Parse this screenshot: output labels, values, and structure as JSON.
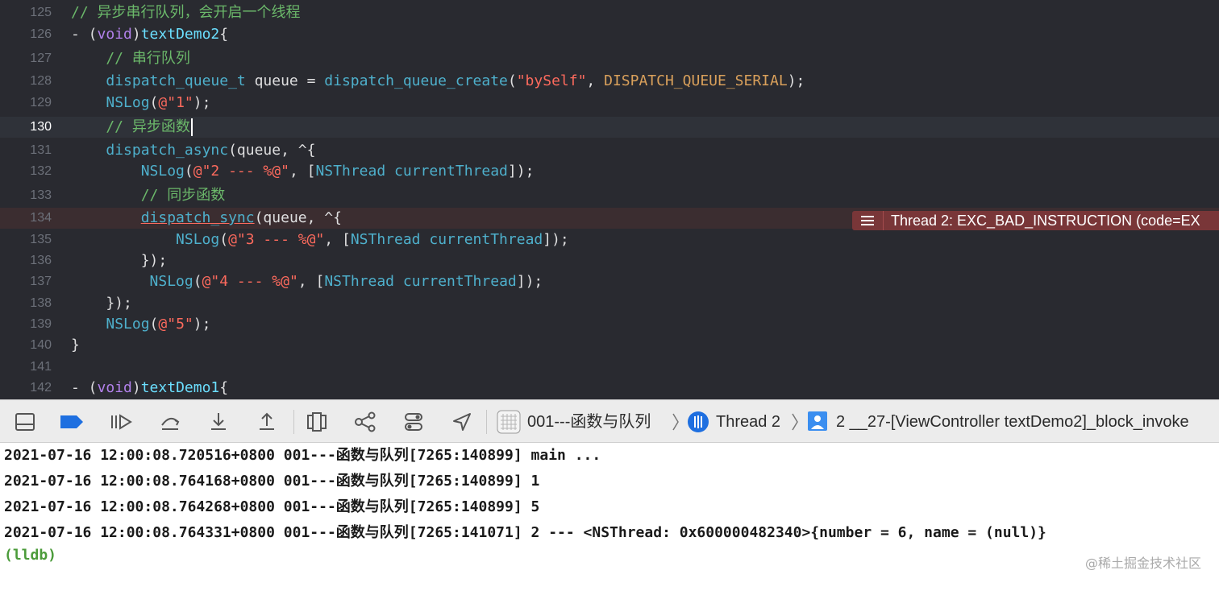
{
  "editor": {
    "lines": [
      {
        "num": "125",
        "tokens": [
          {
            "t": "// 异步串行队列，会开启一个线程",
            "c": "comment"
          }
        ]
      },
      {
        "num": "126",
        "tokens": [
          {
            "t": "- (",
            "c": "plain"
          },
          {
            "t": "void",
            "c": "keyword"
          },
          {
            "t": ")",
            "c": "plain"
          },
          {
            "t": "textDemo2",
            "c": "method"
          },
          {
            "t": "{",
            "c": "plain"
          }
        ]
      },
      {
        "num": "127",
        "tokens": [
          {
            "t": "    // 串行队列",
            "c": "comment"
          }
        ]
      },
      {
        "num": "128",
        "tokens": [
          {
            "t": "    ",
            "c": "plain"
          },
          {
            "t": "dispatch_queue_t",
            "c": "type"
          },
          {
            "t": " queue = ",
            "c": "plain"
          },
          {
            "t": "dispatch_queue_create",
            "c": "func"
          },
          {
            "t": "(",
            "c": "plain"
          },
          {
            "t": "\"bySelf\"",
            "c": "string"
          },
          {
            "t": ", ",
            "c": "plain"
          },
          {
            "t": "DISPATCH_QUEUE_SERIAL",
            "c": "const"
          },
          {
            "t": ");",
            "c": "plain"
          }
        ]
      },
      {
        "num": "129",
        "tokens": [
          {
            "t": "    ",
            "c": "plain"
          },
          {
            "t": "NSLog",
            "c": "func"
          },
          {
            "t": "(",
            "c": "plain"
          },
          {
            "t": "@\"1\"",
            "c": "string"
          },
          {
            "t": ");",
            "c": "plain"
          }
        ]
      },
      {
        "num": "130",
        "current": true,
        "tokens": [
          {
            "t": "    // 异步函数",
            "c": "comment"
          }
        ]
      },
      {
        "num": "131",
        "tokens": [
          {
            "t": "    ",
            "c": "plain"
          },
          {
            "t": "dispatch_async",
            "c": "func"
          },
          {
            "t": "(queue, ^{",
            "c": "plain"
          }
        ]
      },
      {
        "num": "132",
        "tokens": [
          {
            "t": "        ",
            "c": "plain"
          },
          {
            "t": "NSLog",
            "c": "func"
          },
          {
            "t": "(",
            "c": "plain"
          },
          {
            "t": "@\"2 --- %@\"",
            "c": "string"
          },
          {
            "t": ", [",
            "c": "plain"
          },
          {
            "t": "NSThread",
            "c": "type"
          },
          {
            "t": " ",
            "c": "plain"
          },
          {
            "t": "currentThread",
            "c": "func"
          },
          {
            "t": "]);",
            "c": "plain"
          }
        ]
      },
      {
        "num": "133",
        "tokens": [
          {
            "t": "        // 同步函数",
            "c": "comment"
          }
        ]
      },
      {
        "num": "134",
        "error": true,
        "tokens": [
          {
            "t": "        ",
            "c": "plain"
          },
          {
            "t": "dispatch_sync",
            "c": "func",
            "u": true
          },
          {
            "t": "(queue, ^{",
            "c": "plain"
          }
        ]
      },
      {
        "num": "135",
        "tokens": [
          {
            "t": "            ",
            "c": "plain"
          },
          {
            "t": "NSLog",
            "c": "func"
          },
          {
            "t": "(",
            "c": "plain"
          },
          {
            "t": "@\"3 --- %@\"",
            "c": "string"
          },
          {
            "t": ", [",
            "c": "plain"
          },
          {
            "t": "NSThread",
            "c": "type"
          },
          {
            "t": " ",
            "c": "plain"
          },
          {
            "t": "currentThread",
            "c": "func"
          },
          {
            "t": "]);",
            "c": "plain"
          }
        ]
      },
      {
        "num": "136",
        "tokens": [
          {
            "t": "        });",
            "c": "plain"
          }
        ]
      },
      {
        "num": "137",
        "tokens": [
          {
            "t": "         ",
            "c": "plain"
          },
          {
            "t": "NSLog",
            "c": "func"
          },
          {
            "t": "(",
            "c": "plain"
          },
          {
            "t": "@\"4 --- %@\"",
            "c": "string"
          },
          {
            "t": ", [",
            "c": "plain"
          },
          {
            "t": "NSThread",
            "c": "type"
          },
          {
            "t": " ",
            "c": "plain"
          },
          {
            "t": "currentThread",
            "c": "func"
          },
          {
            "t": "]);",
            "c": "plain"
          }
        ]
      },
      {
        "num": "138",
        "tokens": [
          {
            "t": "    });",
            "c": "plain"
          }
        ]
      },
      {
        "num": "139",
        "tokens": [
          {
            "t": "    ",
            "c": "plain"
          },
          {
            "t": "NSLog",
            "c": "func"
          },
          {
            "t": "(",
            "c": "plain"
          },
          {
            "t": "@\"5\"",
            "c": "string"
          },
          {
            "t": ");",
            "c": "plain"
          }
        ]
      },
      {
        "num": "140",
        "tokens": [
          {
            "t": "}",
            "c": "plain"
          }
        ]
      },
      {
        "num": "141",
        "tokens": []
      },
      {
        "num": "142",
        "tokens": [
          {
            "t": "- (",
            "c": "plain"
          },
          {
            "t": "void",
            "c": "keyword"
          },
          {
            "t": ")",
            "c": "plain"
          },
          {
            "t": "textDemo1",
            "c": "method"
          },
          {
            "t": "{",
            "c": "plain"
          }
        ]
      }
    ],
    "error_message": "Thread 2: EXC_BAD_INSTRUCTION (code=EX"
  },
  "debug_bar": {
    "buttons": [
      {
        "name": "hide-debug-area-icon"
      },
      {
        "name": "breakpoints-toggle-icon"
      },
      {
        "name": "continue-icon"
      },
      {
        "name": "step-over-icon"
      },
      {
        "name": "step-into-icon"
      },
      {
        "name": "step-out-icon"
      },
      {
        "name": "view-debugger-icon"
      },
      {
        "name": "memory-graph-icon"
      },
      {
        "name": "environment-overrides-icon"
      },
      {
        "name": "simulate-location-icon"
      }
    ],
    "breadcrumb": {
      "target": "001---函数与队列",
      "thread": "Thread 2",
      "frame": "2 __27-[ViewController textDemo2]_block_invoke"
    },
    "colors": {
      "accent": "#1e6fe0",
      "error": "#793638"
    }
  },
  "console": {
    "lines": [
      "2021-07-16 12:00:08.720516+0800 001---函数与队列[7265:140899] main ...",
      "2021-07-16 12:00:08.764168+0800 001---函数与队列[7265:140899] 1",
      "2021-07-16 12:00:08.764268+0800 001---函数与队列[7265:140899] 5",
      "2021-07-16 12:00:08.764331+0800 001---函数与队列[7265:141071] 2 --- <NSThread: 0x600000482340>{number = 6, name = (null)}"
    ],
    "prompt": "(lldb)"
  },
  "watermark": "@稀土掘金技术社区"
}
